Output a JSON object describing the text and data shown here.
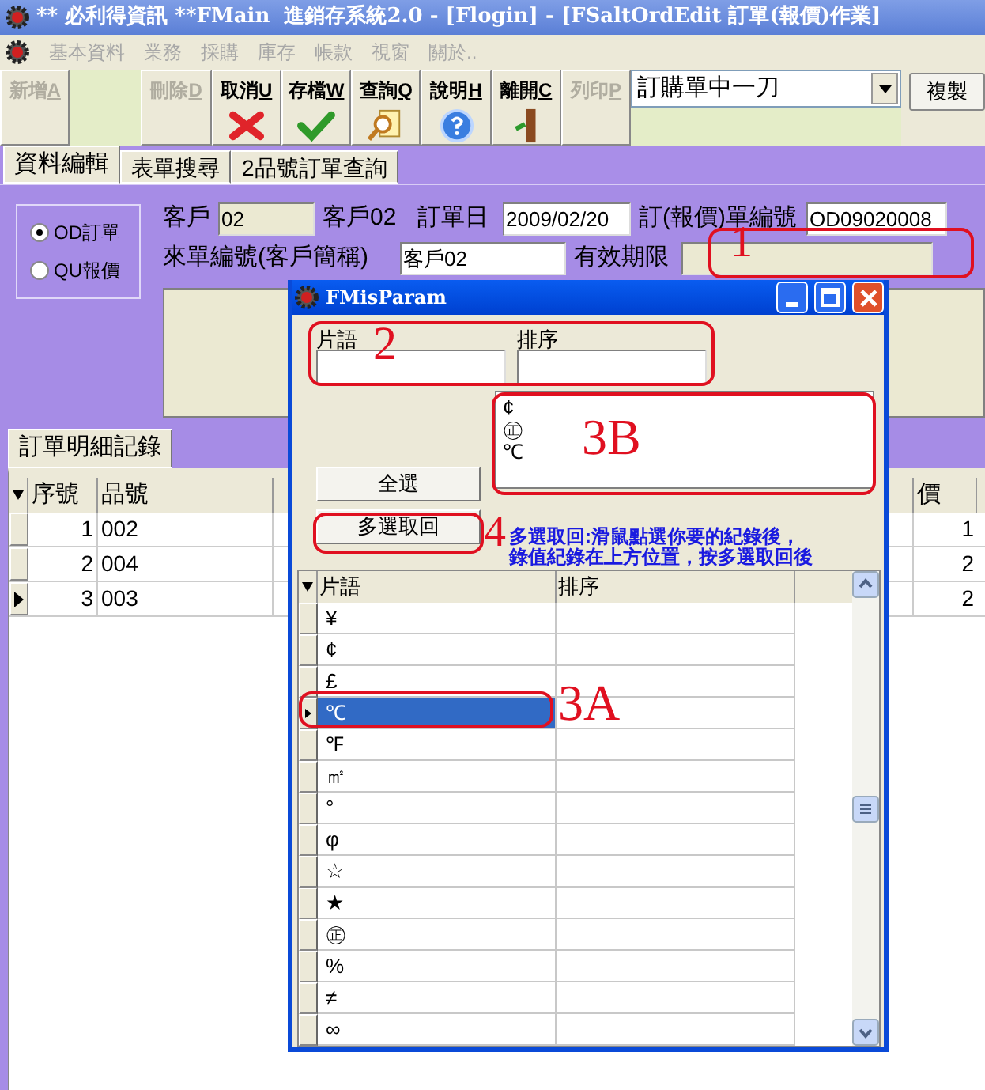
{
  "window": {
    "title": "** 必利得資訊 **FMain  進銷存系統2.0 - [Flogin] - [FSaltOrdEdit 訂單(報價)作業]"
  },
  "menu": [
    {
      "label": "基本資料"
    },
    {
      "label": "業務"
    },
    {
      "label": "採購"
    },
    {
      "label": "庫存"
    },
    {
      "label": "帳款"
    },
    {
      "label": "視窗"
    },
    {
      "label": "關於.."
    }
  ],
  "toolbar": [
    {
      "label": "新增A",
      "kind": "plain",
      "disabled": true
    },
    {
      "kind": "spacer"
    },
    {
      "label": "刪除D",
      "kind": "plain",
      "disabled": true
    },
    {
      "label": "取消U",
      "kind": "cancel",
      "disabled": false
    },
    {
      "label": "存檔W",
      "kind": "save",
      "disabled": false
    },
    {
      "label": "查詢Q",
      "kind": "search",
      "disabled": false
    },
    {
      "label": "說明H",
      "kind": "help",
      "disabled": false
    },
    {
      "label": "離開C",
      "kind": "exit",
      "disabled": false
    },
    {
      "label": "列印P",
      "kind": "plain",
      "disabled": true
    }
  ],
  "template_dropdown": {
    "value": "訂購單中一刀"
  },
  "copy_button": {
    "label": "複製"
  },
  "tabs": [
    {
      "label": "資料編輯",
      "selected": true
    },
    {
      "label": "表單搜尋",
      "selected": false
    },
    {
      "label": "2品號訂單查詢",
      "selected": false
    }
  ],
  "order_type": [
    {
      "label": "OD訂單",
      "selected": true
    },
    {
      "label": "QU報價",
      "selected": false
    }
  ],
  "header_rows": [
    [
      {
        "kind": "label",
        "text": "客戶"
      },
      {
        "kind": "readonly",
        "value": "02"
      },
      {
        "kind": "label",
        "text": "客戶02"
      },
      {
        "kind": "label",
        "text": "訂單日"
      },
      {
        "kind": "input",
        "value": "2009/02/20"
      },
      {
        "kind": "label",
        "text": "訂(報價)單編號"
      },
      {
        "kind": "input",
        "value": "OD09020008"
      }
    ],
    [
      {
        "kind": "label",
        "text": "來單編號(客戶簡稱)"
      },
      {
        "kind": "input",
        "value": "客戶02"
      },
      {
        "kind": "label",
        "text": "有效期限"
      },
      {
        "kind": "readonly"
      }
    ]
  ],
  "detail_tab": {
    "label": "訂單明細記錄",
    "selected": true
  },
  "detail_grid": {
    "columns": [
      "序號",
      "品號",
      "價"
    ],
    "rows": [
      {
        "no": "1",
        "code": "002",
        "column_4": "1",
        "selected": false
      },
      {
        "no": "2",
        "code": "004",
        "column_4": "2",
        "selected": false
      },
      {
        "no": "3",
        "code": "003",
        "column_4": "2",
        "selected": true
      }
    ]
  },
  "dialog": {
    "title": "FMisParam",
    "filters": [
      {
        "label": "片語"
      },
      {
        "label": "排序"
      }
    ],
    "picked": [
      "¢",
      "㊣",
      "℃"
    ],
    "buttons": [
      {
        "label": "全選"
      },
      {
        "label": "多選取回"
      }
    ],
    "note": [
      "多選取回:滑鼠點選你要的紀錄後，",
      "錄值紀錄在上方位置，按多選取回後"
    ],
    "grid": {
      "columns": [
        "片語",
        "排序"
      ],
      "rows": [
        {
          "phrase": "¥",
          "selected": false
        },
        {
          "phrase": "¢",
          "selected": false
        },
        {
          "phrase": "£",
          "selected": false
        },
        {
          "phrase": "℃",
          "selected": true
        },
        {
          "phrase": "℉",
          "selected": false
        },
        {
          "phrase": "㎡",
          "selected": false
        },
        {
          "phrase": "°",
          "selected": false
        },
        {
          "phrase": "φ",
          "selected": false
        },
        {
          "phrase": "☆",
          "selected": false
        },
        {
          "phrase": "★",
          "selected": false
        },
        {
          "phrase": "㊣",
          "selected": false
        },
        {
          "phrase": "%",
          "selected": false
        },
        {
          "phrase": "≠",
          "selected": false
        },
        {
          "phrase": "∞",
          "selected": false
        }
      ]
    }
  },
  "annotations": [
    {
      "label": "1"
    },
    {
      "label": "2"
    },
    {
      "label": "3B"
    },
    {
      "label": "3A"
    },
    {
      "label": "4"
    }
  ]
}
